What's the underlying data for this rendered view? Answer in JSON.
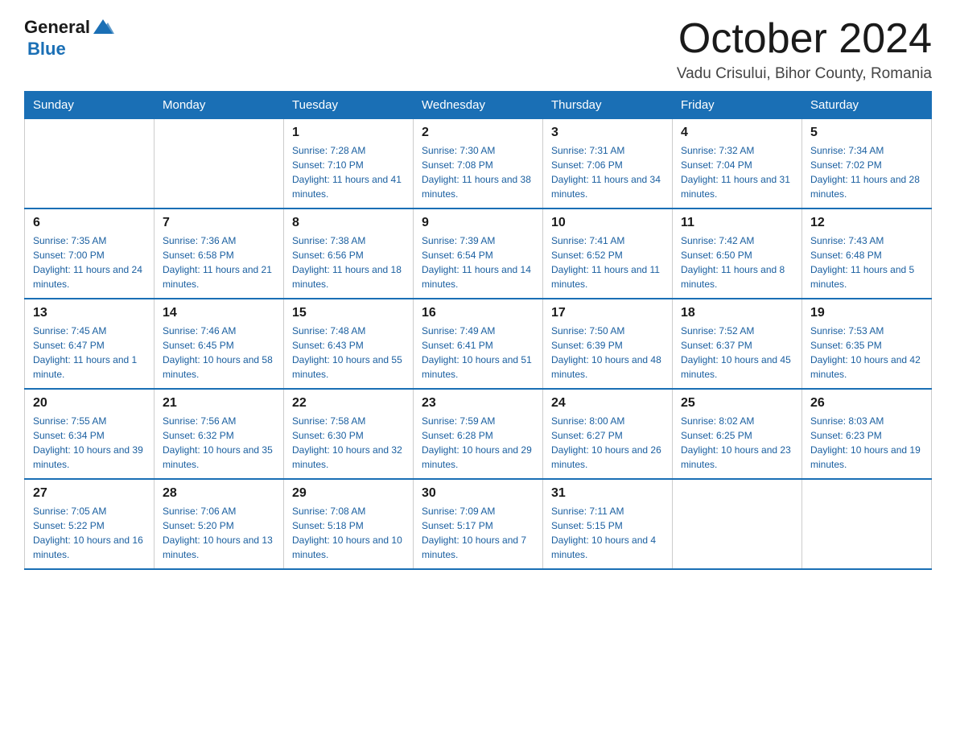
{
  "header": {
    "logo_general": "General",
    "logo_blue": "Blue",
    "month": "October 2024",
    "location": "Vadu Crisului, Bihor County, Romania"
  },
  "weekdays": [
    "Sunday",
    "Monday",
    "Tuesday",
    "Wednesday",
    "Thursday",
    "Friday",
    "Saturday"
  ],
  "weeks": [
    [
      {
        "day": "",
        "sunrise": "",
        "sunset": "",
        "daylight": ""
      },
      {
        "day": "",
        "sunrise": "",
        "sunset": "",
        "daylight": ""
      },
      {
        "day": "1",
        "sunrise": "Sunrise: 7:28 AM",
        "sunset": "Sunset: 7:10 PM",
        "daylight": "Daylight: 11 hours and 41 minutes."
      },
      {
        "day": "2",
        "sunrise": "Sunrise: 7:30 AM",
        "sunset": "Sunset: 7:08 PM",
        "daylight": "Daylight: 11 hours and 38 minutes."
      },
      {
        "day": "3",
        "sunrise": "Sunrise: 7:31 AM",
        "sunset": "Sunset: 7:06 PM",
        "daylight": "Daylight: 11 hours and 34 minutes."
      },
      {
        "day": "4",
        "sunrise": "Sunrise: 7:32 AM",
        "sunset": "Sunset: 7:04 PM",
        "daylight": "Daylight: 11 hours and 31 minutes."
      },
      {
        "day": "5",
        "sunrise": "Sunrise: 7:34 AM",
        "sunset": "Sunset: 7:02 PM",
        "daylight": "Daylight: 11 hours and 28 minutes."
      }
    ],
    [
      {
        "day": "6",
        "sunrise": "Sunrise: 7:35 AM",
        "sunset": "Sunset: 7:00 PM",
        "daylight": "Daylight: 11 hours and 24 minutes."
      },
      {
        "day": "7",
        "sunrise": "Sunrise: 7:36 AM",
        "sunset": "Sunset: 6:58 PM",
        "daylight": "Daylight: 11 hours and 21 minutes."
      },
      {
        "day": "8",
        "sunrise": "Sunrise: 7:38 AM",
        "sunset": "Sunset: 6:56 PM",
        "daylight": "Daylight: 11 hours and 18 minutes."
      },
      {
        "day": "9",
        "sunrise": "Sunrise: 7:39 AM",
        "sunset": "Sunset: 6:54 PM",
        "daylight": "Daylight: 11 hours and 14 minutes."
      },
      {
        "day": "10",
        "sunrise": "Sunrise: 7:41 AM",
        "sunset": "Sunset: 6:52 PM",
        "daylight": "Daylight: 11 hours and 11 minutes."
      },
      {
        "day": "11",
        "sunrise": "Sunrise: 7:42 AM",
        "sunset": "Sunset: 6:50 PM",
        "daylight": "Daylight: 11 hours and 8 minutes."
      },
      {
        "day": "12",
        "sunrise": "Sunrise: 7:43 AM",
        "sunset": "Sunset: 6:48 PM",
        "daylight": "Daylight: 11 hours and 5 minutes."
      }
    ],
    [
      {
        "day": "13",
        "sunrise": "Sunrise: 7:45 AM",
        "sunset": "Sunset: 6:47 PM",
        "daylight": "Daylight: 11 hours and 1 minute."
      },
      {
        "day": "14",
        "sunrise": "Sunrise: 7:46 AM",
        "sunset": "Sunset: 6:45 PM",
        "daylight": "Daylight: 10 hours and 58 minutes."
      },
      {
        "day": "15",
        "sunrise": "Sunrise: 7:48 AM",
        "sunset": "Sunset: 6:43 PM",
        "daylight": "Daylight: 10 hours and 55 minutes."
      },
      {
        "day": "16",
        "sunrise": "Sunrise: 7:49 AM",
        "sunset": "Sunset: 6:41 PM",
        "daylight": "Daylight: 10 hours and 51 minutes."
      },
      {
        "day": "17",
        "sunrise": "Sunrise: 7:50 AM",
        "sunset": "Sunset: 6:39 PM",
        "daylight": "Daylight: 10 hours and 48 minutes."
      },
      {
        "day": "18",
        "sunrise": "Sunrise: 7:52 AM",
        "sunset": "Sunset: 6:37 PM",
        "daylight": "Daylight: 10 hours and 45 minutes."
      },
      {
        "day": "19",
        "sunrise": "Sunrise: 7:53 AM",
        "sunset": "Sunset: 6:35 PM",
        "daylight": "Daylight: 10 hours and 42 minutes."
      }
    ],
    [
      {
        "day": "20",
        "sunrise": "Sunrise: 7:55 AM",
        "sunset": "Sunset: 6:34 PM",
        "daylight": "Daylight: 10 hours and 39 minutes."
      },
      {
        "day": "21",
        "sunrise": "Sunrise: 7:56 AM",
        "sunset": "Sunset: 6:32 PM",
        "daylight": "Daylight: 10 hours and 35 minutes."
      },
      {
        "day": "22",
        "sunrise": "Sunrise: 7:58 AM",
        "sunset": "Sunset: 6:30 PM",
        "daylight": "Daylight: 10 hours and 32 minutes."
      },
      {
        "day": "23",
        "sunrise": "Sunrise: 7:59 AM",
        "sunset": "Sunset: 6:28 PM",
        "daylight": "Daylight: 10 hours and 29 minutes."
      },
      {
        "day": "24",
        "sunrise": "Sunrise: 8:00 AM",
        "sunset": "Sunset: 6:27 PM",
        "daylight": "Daylight: 10 hours and 26 minutes."
      },
      {
        "day": "25",
        "sunrise": "Sunrise: 8:02 AM",
        "sunset": "Sunset: 6:25 PM",
        "daylight": "Daylight: 10 hours and 23 minutes."
      },
      {
        "day": "26",
        "sunrise": "Sunrise: 8:03 AM",
        "sunset": "Sunset: 6:23 PM",
        "daylight": "Daylight: 10 hours and 19 minutes."
      }
    ],
    [
      {
        "day": "27",
        "sunrise": "Sunrise: 7:05 AM",
        "sunset": "Sunset: 5:22 PM",
        "daylight": "Daylight: 10 hours and 16 minutes."
      },
      {
        "day": "28",
        "sunrise": "Sunrise: 7:06 AM",
        "sunset": "Sunset: 5:20 PM",
        "daylight": "Daylight: 10 hours and 13 minutes."
      },
      {
        "day": "29",
        "sunrise": "Sunrise: 7:08 AM",
        "sunset": "Sunset: 5:18 PM",
        "daylight": "Daylight: 10 hours and 10 minutes."
      },
      {
        "day": "30",
        "sunrise": "Sunrise: 7:09 AM",
        "sunset": "Sunset: 5:17 PM",
        "daylight": "Daylight: 10 hours and 7 minutes."
      },
      {
        "day": "31",
        "sunrise": "Sunrise: 7:11 AM",
        "sunset": "Sunset: 5:15 PM",
        "daylight": "Daylight: 10 hours and 4 minutes."
      },
      {
        "day": "",
        "sunrise": "",
        "sunset": "",
        "daylight": ""
      },
      {
        "day": "",
        "sunrise": "",
        "sunset": "",
        "daylight": ""
      }
    ]
  ]
}
